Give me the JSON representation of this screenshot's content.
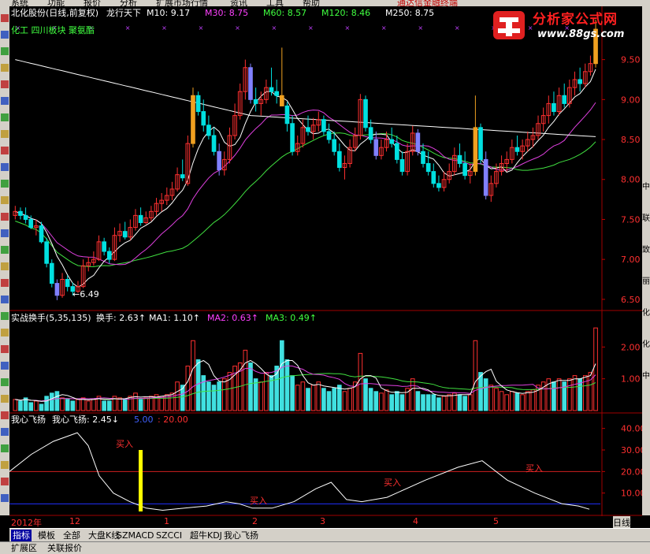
{
  "menu": [
    "系统",
    "功能",
    "报价",
    "分析",
    "扩展市场行情",
    "资讯",
    "工具",
    "帮助"
  ],
  "menu_extra": "通达信金融终端",
  "logo": {
    "name": "分析家公式网",
    "url": "www.88gs.com"
  },
  "main_panel": {
    "stock": "北化股份(日线,前复权)",
    "formula": "龙行天下",
    "ma": [
      {
        "label": "M10:",
        "value": "9.17",
        "color": "#ffffff"
      },
      {
        "label": "M30:",
        "value": "8.75",
        "color": "#ff40ff"
      },
      {
        "label": "M60:",
        "value": "8.57",
        "color": "#40ff40"
      },
      {
        "label": "M120:",
        "value": "8.46",
        "color": "#40ff40"
      },
      {
        "label": "M250:",
        "value": "8.75",
        "color": "#ffffff"
      }
    ],
    "sector": "化工 四川板块 聚氨酯",
    "low_label": "←6.49",
    "y_ticks": [
      "9.50",
      "9.00",
      "8.50",
      "8.00",
      "7.50",
      "7.00",
      "6.50"
    ]
  },
  "turnover_panel": {
    "title": "实战换手(5,35,135)",
    "values": [
      {
        "label": "换手:",
        "value": "2.63",
        "color": "#ffffff"
      },
      {
        "label": "MA1:",
        "value": "1.10",
        "color": "#ffffff"
      },
      {
        "label": "MA2:",
        "value": "0.63",
        "color": "#ff40ff"
      },
      {
        "label": "MA3:",
        "value": "0.49",
        "color": "#40ff40"
      }
    ],
    "y_ticks": [
      "2.00",
      "1.00"
    ]
  },
  "osc_panel": {
    "title": "我心飞扬",
    "name": "我心飞扬:",
    "value": "2.45",
    "level1": "5.00",
    "level2": "20.00",
    "buy_label": "买入",
    "y_ticks": [
      "40.00",
      "30.00",
      "20.00",
      "10.00"
    ]
  },
  "time_axis": {
    "labels": [
      "2012年",
      "12",
      "1",
      "2",
      "3",
      "4",
      "5"
    ],
    "period": "日线"
  },
  "tabs": [
    "指标",
    "模板",
    "全部",
    "大盘K线",
    "SZMACD",
    "SZCCI",
    "超牛KDJ",
    "我心飞扬"
  ],
  "active_tab": "指标",
  "status": [
    "扩展区",
    "关联报价"
  ],
  "right_strip": [
    "中",
    "联",
    "致",
    "丽",
    "化",
    "化",
    "中"
  ],
  "chart_data": {
    "type": "candlestick",
    "price_range": [
      6.4,
      9.95
    ],
    "candles": [
      [
        7.55,
        7.62,
        7.5,
        7.6
      ],
      [
        7.6,
        7.58,
        7.5,
        7.55
      ],
      [
        7.55,
        7.6,
        7.45,
        7.5
      ],
      [
        7.5,
        7.45,
        7.38,
        7.4
      ],
      [
        7.4,
        7.45,
        7.3,
        7.42
      ],
      [
        7.42,
        7.3,
        7.2,
        7.22
      ],
      [
        7.22,
        6.95,
        6.9,
        6.95
      ],
      [
        6.95,
        6.8,
        6.65,
        6.7
      ],
      [
        6.7,
        6.55,
        6.49,
        6.55
      ],
      [
        6.55,
        6.78,
        6.52,
        6.75
      ],
      [
        6.75,
        6.68,
        6.6,
        6.66
      ],
      [
        6.66,
        6.62,
        6.55,
        6.6
      ],
      [
        6.6,
        6.68,
        6.58,
        6.66
      ],
      [
        6.66,
        6.95,
        6.64,
        6.92
      ],
      [
        6.92,
        6.98,
        6.85,
        6.96
      ],
      [
        6.96,
        7.05,
        6.92,
        7.0
      ],
      [
        7.0,
        7.25,
        6.98,
        7.22
      ],
      [
        7.22,
        7.18,
        7.05,
        7.1
      ],
      [
        7.1,
        7.08,
        6.95,
        7.0
      ],
      [
        7.0,
        7.35,
        6.98,
        7.3
      ],
      [
        7.3,
        7.4,
        7.22,
        7.35
      ],
      [
        7.35,
        7.42,
        7.25,
        7.28
      ],
      [
        7.28,
        7.45,
        7.24,
        7.4
      ],
      [
        7.4,
        7.58,
        7.36,
        7.55
      ],
      [
        7.55,
        7.6,
        7.42,
        7.46
      ],
      [
        7.46,
        7.55,
        7.44,
        7.52
      ],
      [
        7.52,
        7.62,
        7.48,
        7.6
      ],
      [
        7.6,
        7.72,
        7.55,
        7.7
      ],
      [
        7.7,
        7.78,
        7.6,
        7.74
      ],
      [
        7.74,
        7.85,
        7.68,
        7.8
      ],
      [
        7.8,
        7.92,
        7.74,
        7.88
      ],
      [
        7.88,
        8.1,
        7.85,
        8.06
      ],
      [
        8.06,
        8.2,
        7.98,
        8.02
      ],
      [
        7.95,
        8.5,
        7.92,
        8.45
      ],
      [
        8.45,
        9.1,
        8.4,
        9.05
      ],
      [
        9.05,
        9.0,
        8.8,
        8.85
      ],
      [
        8.85,
        8.95,
        8.6,
        8.68
      ],
      [
        8.68,
        8.75,
        8.5,
        8.55
      ],
      [
        8.55,
        8.6,
        8.3,
        8.35
      ],
      [
        8.35,
        8.4,
        8.05,
        8.12
      ],
      [
        8.12,
        8.3,
        8.05,
        8.25
      ],
      [
        8.25,
        8.6,
        8.2,
        8.55
      ],
      [
        8.55,
        8.9,
        8.5,
        8.8
      ],
      [
        8.8,
        9.15,
        8.75,
        9.1
      ],
      [
        9.1,
        9.45,
        9.0,
        9.4
      ],
      [
        9.4,
        9.35,
        8.95,
        9.0
      ],
      [
        9.0,
        9.1,
        8.85,
        8.95
      ],
      [
        8.95,
        9.05,
        8.8,
        9.0
      ],
      [
        9.0,
        9.2,
        8.95,
        9.15
      ],
      [
        9.15,
        9.35,
        9.05,
        9.1
      ],
      [
        9.1,
        9.2,
        8.95,
        9.05
      ],
      [
        9.05,
        9.6,
        9.0,
        8.92
      ],
      [
        8.92,
        8.9,
        8.6,
        8.7
      ],
      [
        8.7,
        8.75,
        8.3,
        8.35
      ],
      [
        8.35,
        8.5,
        8.3,
        8.45
      ],
      [
        8.45,
        8.7,
        8.4,
        8.65
      ],
      [
        8.65,
        8.75,
        8.55,
        8.6
      ],
      [
        8.6,
        8.72,
        8.5,
        8.68
      ],
      [
        8.68,
        8.8,
        8.6,
        8.75
      ],
      [
        8.75,
        8.72,
        8.55,
        8.6
      ],
      [
        8.6,
        8.65,
        8.45,
        8.5
      ],
      [
        8.5,
        8.55,
        8.3,
        8.35
      ],
      [
        8.35,
        8.4,
        8.1,
        8.15
      ],
      [
        8.15,
        8.25,
        8.0,
        8.2
      ],
      [
        8.2,
        8.45,
        8.15,
        8.4
      ],
      [
        8.4,
        8.6,
        8.35,
        8.55
      ],
      [
        8.55,
        9.02,
        8.5,
        9.0
      ],
      [
        9.0,
        8.95,
        8.6,
        8.65
      ],
      [
        8.65,
        8.7,
        8.45,
        8.5
      ],
      [
        8.5,
        8.55,
        8.25,
        8.3
      ],
      [
        8.3,
        8.45,
        8.25,
        8.4
      ],
      [
        8.4,
        8.55,
        8.35,
        8.5
      ],
      [
        8.5,
        8.6,
        8.4,
        8.45
      ],
      [
        8.45,
        8.5,
        8.2,
        8.25
      ],
      [
        8.25,
        8.3,
        8.05,
        8.1
      ],
      [
        8.1,
        8.4,
        8.05,
        8.35
      ],
      [
        8.35,
        8.62,
        8.3,
        8.58
      ],
      [
        8.58,
        8.55,
        8.3,
        8.35
      ],
      [
        8.35,
        8.4,
        8.15,
        8.2
      ],
      [
        8.2,
        8.3,
        8.05,
        8.1
      ],
      [
        8.1,
        8.15,
        7.9,
        7.95
      ],
      [
        7.95,
        8.0,
        7.85,
        7.9
      ],
      [
        7.9,
        8.05,
        7.85,
        8.0
      ],
      [
        8.0,
        8.15,
        7.95,
        8.1
      ],
      [
        8.1,
        8.35,
        8.05,
        8.3
      ],
      [
        8.3,
        8.4,
        8.15,
        8.2
      ],
      [
        8.2,
        8.3,
        8.0,
        8.05
      ],
      [
        8.05,
        8.15,
        7.95,
        8.1
      ],
      [
        8.1,
        9.0,
        8.05,
        8.65
      ],
      [
        8.65,
        8.6,
        8.2,
        8.25
      ],
      [
        8.25,
        8.3,
        7.75,
        7.8
      ],
      [
        7.8,
        8.0,
        7.72,
        7.95
      ],
      [
        7.95,
        8.15,
        7.9,
        8.1
      ],
      [
        8.1,
        8.25,
        8.05,
        8.2
      ],
      [
        8.2,
        8.3,
        8.1,
        8.25
      ],
      [
        8.25,
        8.45,
        8.2,
        8.4
      ],
      [
        8.4,
        8.5,
        8.3,
        8.35
      ],
      [
        8.35,
        8.45,
        8.25,
        8.42
      ],
      [
        8.42,
        8.55,
        8.35,
        8.5
      ],
      [
        8.5,
        8.6,
        8.4,
        8.55
      ],
      [
        8.55,
        8.75,
        8.5,
        8.7
      ],
      [
        8.7,
        8.85,
        8.6,
        8.8
      ],
      [
        8.8,
        9.0,
        8.7,
        8.95
      ],
      [
        8.95,
        9.05,
        8.8,
        8.85
      ],
      [
        8.85,
        9.1,
        8.8,
        9.05
      ],
      [
        9.05,
        9.15,
        8.9,
        8.95
      ],
      [
        8.95,
        9.2,
        8.9,
        9.15
      ],
      [
        9.15,
        9.3,
        9.05,
        9.25
      ],
      [
        9.25,
        9.35,
        9.1,
        9.2
      ],
      [
        9.2,
        9.4,
        9.15,
        9.35
      ],
      [
        9.35,
        9.5,
        9.3,
        9.45
      ],
      [
        9.45,
        9.95,
        9.4,
        9.88
      ]
    ],
    "orange_bars": [
      34,
      51,
      88,
      111
    ],
    "blue_bars": [
      8,
      39,
      45,
      69,
      77,
      90
    ],
    "turnover": [
      0.35,
      0.3,
      0.4,
      0.25,
      0.3,
      0.2,
      0.45,
      0.55,
      0.6,
      0.4,
      0.35,
      0.3,
      0.35,
      0.4,
      0.3,
      0.35,
      0.45,
      0.3,
      0.3,
      0.45,
      0.4,
      0.35,
      0.45,
      0.55,
      0.35,
      0.4,
      0.45,
      0.5,
      0.45,
      0.5,
      0.55,
      0.9,
      0.8,
      1.4,
      2.2,
      1.6,
      1.1,
      0.9,
      0.8,
      0.9,
      1.0,
      1.2,
      1.4,
      1.5,
      1.9,
      1.5,
      1.0,
      0.9,
      1.2,
      1.1,
      1.4,
      2.2,
      1.6,
      1.1,
      0.8,
      0.9,
      0.7,
      0.8,
      0.9,
      0.7,
      0.6,
      0.7,
      0.8,
      0.6,
      0.7,
      0.9,
      1.8,
      1.0,
      0.7,
      0.6,
      0.55,
      0.65,
      0.5,
      0.6,
      0.5,
      0.7,
      1.0,
      0.6,
      0.5,
      0.5,
      0.5,
      0.4,
      0.45,
      0.5,
      0.55,
      0.5,
      0.45,
      0.5,
      2.2,
      1.2,
      1.0,
      0.8,
      0.7,
      0.6,
      0.5,
      0.6,
      0.55,
      0.5,
      0.6,
      0.65,
      0.8,
      0.9,
      1.0,
      0.9,
      1.0,
      0.9,
      1.0,
      1.1,
      1.0,
      1.1,
      1.2,
      2.6
    ],
    "oscillator_points": [
      [
        0,
        20
      ],
      [
        20,
        28
      ],
      [
        40,
        34
      ],
      [
        62,
        38
      ],
      [
        72,
        32
      ],
      [
        82,
        18
      ],
      [
        95,
        10
      ],
      [
        110,
        6
      ],
      [
        125,
        3
      ],
      [
        140,
        2
      ],
      [
        160,
        3
      ],
      [
        180,
        4
      ],
      [
        198,
        6
      ],
      [
        210,
        5
      ],
      [
        222,
        3
      ],
      [
        240,
        3
      ],
      [
        260,
        6
      ],
      [
        280,
        12
      ],
      [
        294,
        15
      ],
      [
        308,
        7
      ],
      [
        322,
        6
      ],
      [
        345,
        8
      ],
      [
        380,
        16
      ],
      [
        410,
        22
      ],
      [
        432,
        25
      ],
      [
        455,
        16
      ],
      [
        480,
        10
      ],
      [
        505,
        5
      ],
      [
        520,
        4
      ],
      [
        530,
        2.5
      ]
    ]
  }
}
